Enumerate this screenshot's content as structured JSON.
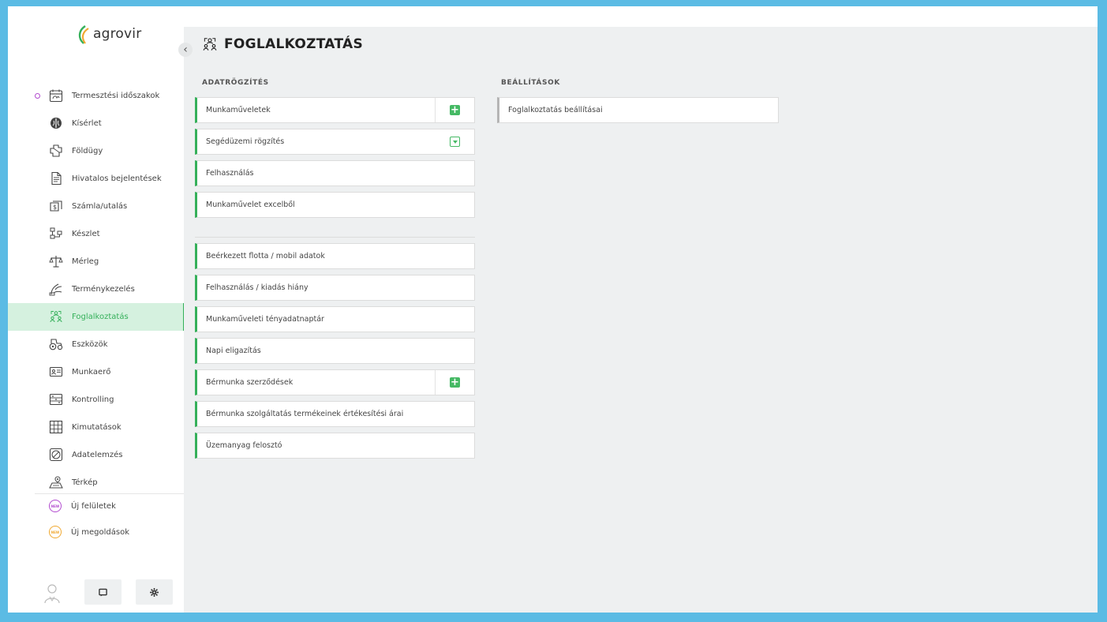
{
  "app": {
    "logo_text": "agrovir"
  },
  "sidebar": {
    "items": [
      {
        "label": "Termesztési időszakok",
        "icon": "calendar-icon"
      },
      {
        "label": "Kísérlet",
        "icon": "experiment-icon"
      },
      {
        "label": "Földügy",
        "icon": "land-icon"
      },
      {
        "label": "Hivatalos bejelentések",
        "icon": "document-icon"
      },
      {
        "label": "Számla/utalás",
        "icon": "invoice-icon"
      },
      {
        "label": "Készlet",
        "icon": "stock-icon"
      },
      {
        "label": "Mérleg",
        "icon": "scale-icon"
      },
      {
        "label": "Terménykezelés",
        "icon": "crop-icon"
      },
      {
        "label": "Foglalkoztatás",
        "icon": "employment-icon",
        "active": true
      },
      {
        "label": "Eszközök",
        "icon": "tractor-icon"
      },
      {
        "label": "Munkaerő",
        "icon": "id-card-icon"
      },
      {
        "label": "Kontrolling",
        "icon": "controlling-icon"
      },
      {
        "label": "Kimutatások",
        "icon": "report-icon"
      },
      {
        "label": "Adatelemzés",
        "icon": "analysis-icon"
      },
      {
        "label": "Térkép",
        "icon": "map-icon"
      }
    ],
    "new_items": [
      {
        "label": "Új felületek",
        "badge": "NEW",
        "color": "#b24bcf"
      },
      {
        "label": "Új megoldások",
        "badge": "NEW",
        "color": "#f0a830"
      }
    ]
  },
  "page": {
    "title": "FOGLALKOZTATÁS"
  },
  "sections": {
    "adatrogzites": {
      "title": "ADATRÖGZÍTÉS",
      "items": [
        "Munkaműveletek",
        "Segédüzemi rögzítés",
        "Felhasználás",
        "Munkaművelet excelből",
        "Beérkezett flotta / mobil adatok",
        "Felhasználás / kiadás hiány",
        "Munkaműveleti tényadatnaptár",
        "Napi eligazítás",
        "Bérmunka szerződések",
        "Bérmunka szolgáltatás termékeinek értékesítési árai",
        "Üzemanyag felosztó"
      ]
    },
    "beallitasok": {
      "title": "BEÁLLÍTÁSOK",
      "items": [
        "Foglalkoztatás beállításai"
      ]
    }
  },
  "colors": {
    "accent": "#35b05a",
    "active_bg": "#d5f1df",
    "frame": "#5bbbe4",
    "main_bg": "#eef0f1"
  }
}
